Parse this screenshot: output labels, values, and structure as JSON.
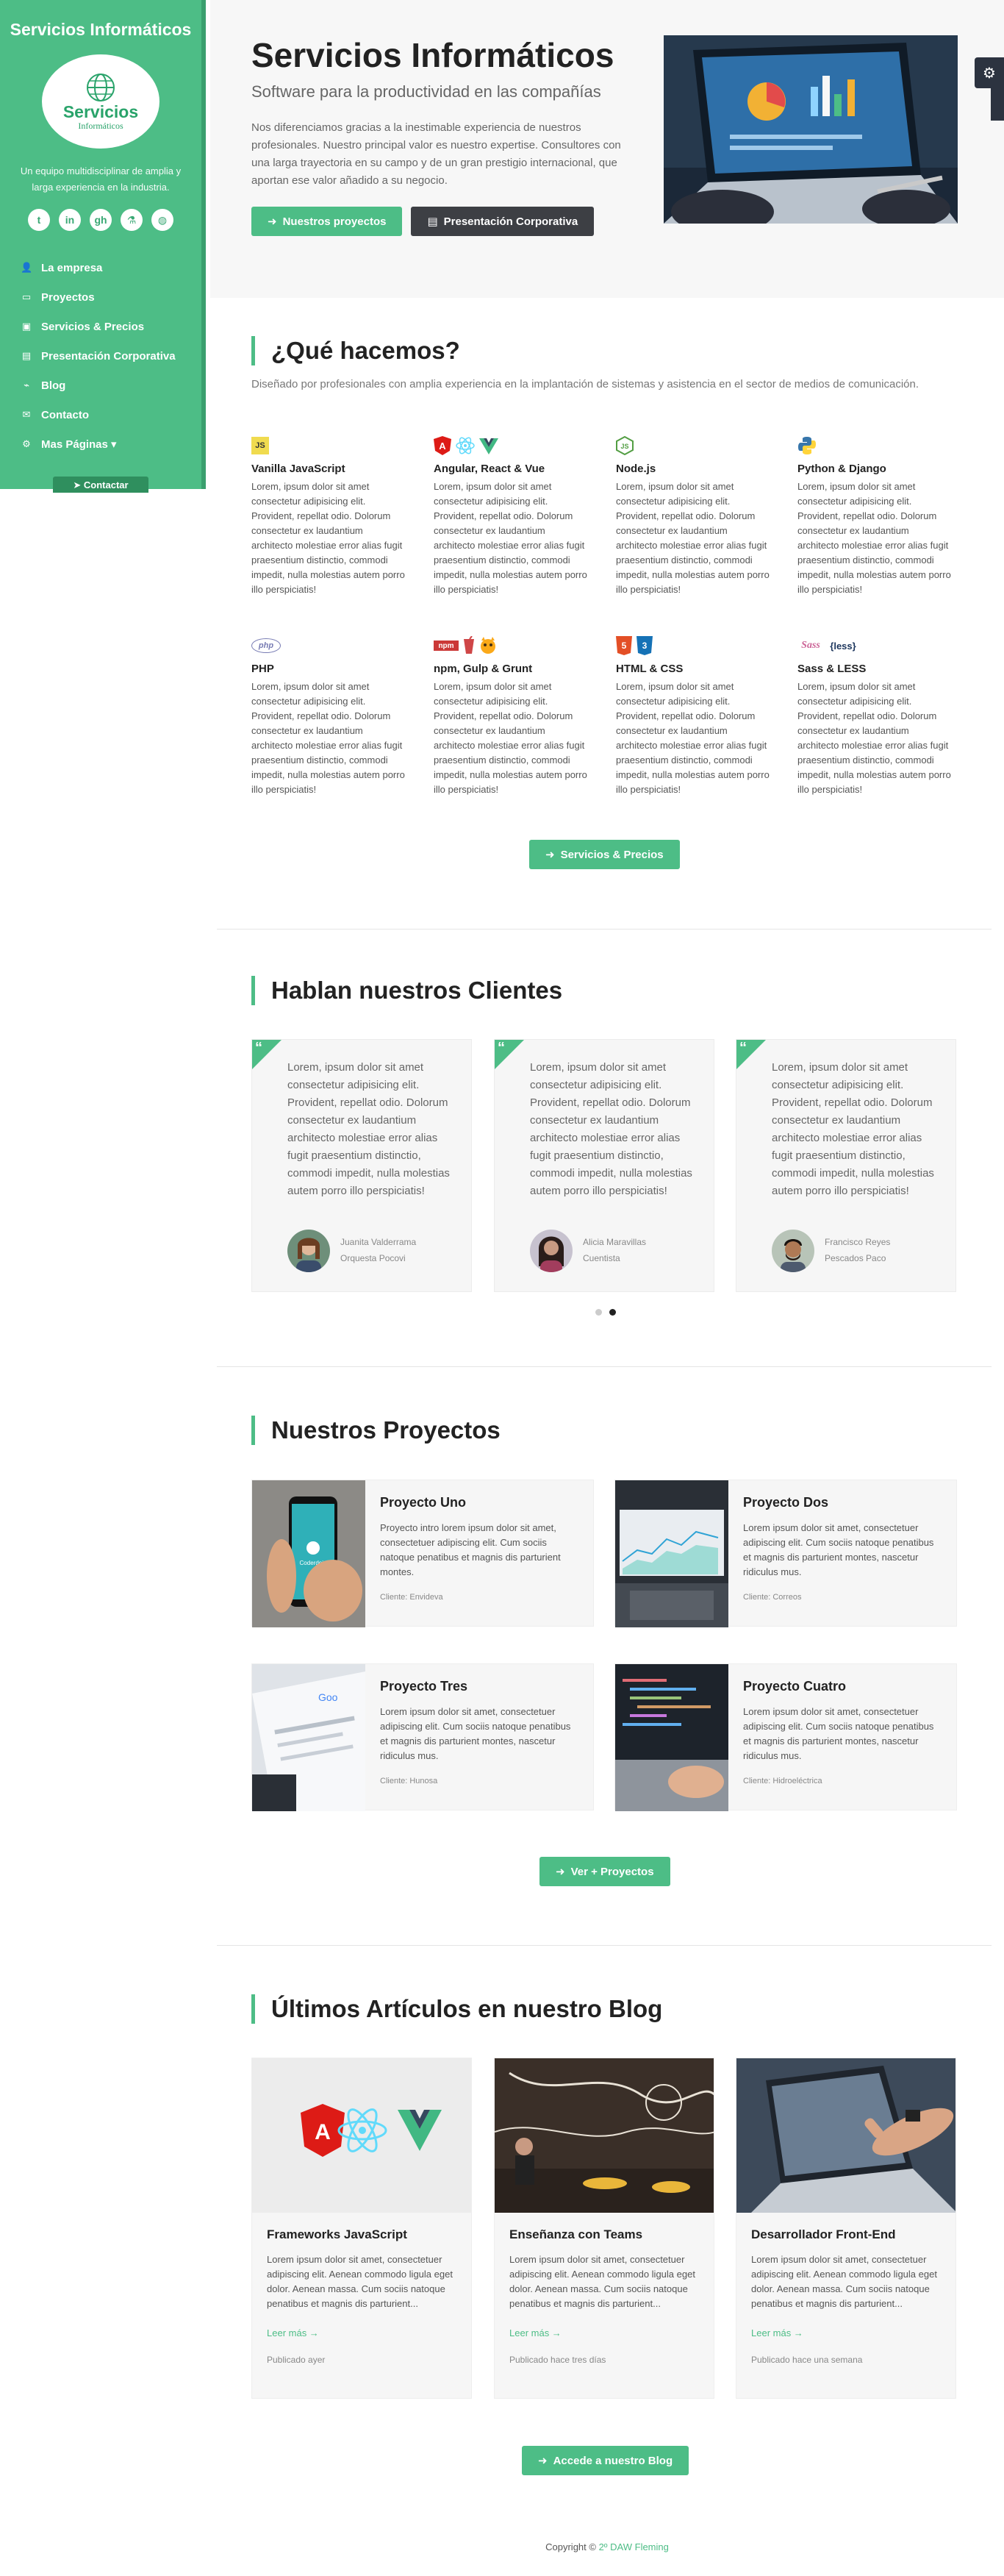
{
  "sidebar": {
    "title": "Servicios Informáticos",
    "logo_line1": "Servicios",
    "logo_line2": "Informáticos",
    "tagline": "Un equipo multidisciplinar de amplia y larga experiencia en la industria.",
    "social": [
      {
        "icon": "twitter-icon",
        "glyph": "t"
      },
      {
        "icon": "linkedin-icon",
        "glyph": "in"
      },
      {
        "icon": "github-icon",
        "glyph": "gh"
      },
      {
        "icon": "flask-icon",
        "glyph": "⚗"
      },
      {
        "icon": "globe-icon",
        "glyph": "◍"
      }
    ],
    "nav": [
      {
        "label": "La empresa",
        "icon": "user-icon",
        "glyph": "👤"
      },
      {
        "label": "Proyectos",
        "icon": "monitor-icon",
        "glyph": "▭"
      },
      {
        "label": "Servicios & Precios",
        "icon": "briefcase-icon",
        "glyph": "▣"
      },
      {
        "label": "Presentación Corporativa",
        "icon": "file-icon",
        "glyph": "▤"
      },
      {
        "label": "Blog",
        "icon": "rss-icon",
        "glyph": "⌁"
      },
      {
        "label": "Contacto",
        "icon": "envelope-icon",
        "glyph": "✉"
      },
      {
        "label": "Mas Páginas ▾",
        "icon": "cogs-icon",
        "glyph": "⚙"
      }
    ],
    "contact_button": "Contactar"
  },
  "hero": {
    "title": "Servicios Informáticos",
    "subtitle": "Software para la productividad en las compañías",
    "text": "Nos diferenciamos gracias a la inestimable experiencia de nuestros profesionales. Nuestro principal valor es nuestro expertise. Consultores con una larga trayectoria en su campo y de un gran prestigio internacional, que aportan ese valor añadido a su negocio.",
    "btn_projects": "Nuestros proyectos",
    "btn_presentation": "Presentación Corporativa"
  },
  "services": {
    "title": "¿Qué hacemos?",
    "subtitle": "Diseñado por profesionales con amplia experiencia en la implantación de sistemas y asistencia en el sector de medios de comunicación.",
    "items": [
      {
        "name": "Vanilla JavaScript",
        "text": "Lorem, ipsum dolor sit amet consectetur adipisicing elit. Provident, repellat odio. Dolorum consectetur ex laudantium architecto molestiae error alias fugit praesentium distinctio, commodi impedit, nulla molestias autem porro illo perspiciatis!"
      },
      {
        "name": "Angular, React & Vue",
        "text": "Lorem, ipsum dolor sit amet consectetur adipisicing elit. Provident, repellat odio. Dolorum consectetur ex laudantium architecto molestiae error alias fugit praesentium distinctio, commodi impedit, nulla molestias autem porro illo perspiciatis!"
      },
      {
        "name": "Node.js",
        "text": "Lorem, ipsum dolor sit amet consectetur adipisicing elit. Provident, repellat odio. Dolorum consectetur ex laudantium architecto molestiae error alias fugit praesentium distinctio, commodi impedit, nulla molestias autem porro illo perspiciatis!"
      },
      {
        "name": "Python & Django",
        "text": "Lorem, ipsum dolor sit amet consectetur adipisicing elit. Provident, repellat odio. Dolorum consectetur ex laudantium architecto molestiae error alias fugit praesentium distinctio, commodi impedit, nulla molestias autem porro illo perspiciatis!"
      },
      {
        "name": "PHP",
        "text": "Lorem, ipsum dolor sit amet consectetur adipisicing elit. Provident, repellat odio. Dolorum consectetur ex laudantium architecto molestiae error alias fugit praesentium distinctio, commodi impedit, nulla molestias autem porro illo perspiciatis!"
      },
      {
        "name": "npm, Gulp & Grunt",
        "text": "Lorem, ipsum dolor sit amet consectetur adipisicing elit. Provident, repellat odio. Dolorum consectetur ex laudantium architecto molestiae error alias fugit praesentium distinctio, commodi impedit, nulla molestias autem porro illo perspiciatis!"
      },
      {
        "name": "HTML & CSS",
        "text": "Lorem, ipsum dolor sit amet consectetur adipisicing elit. Provident, repellat odio. Dolorum consectetur ex laudantium architecto molestiae error alias fugit praesentium distinctio, commodi impedit, nulla molestias autem porro illo perspiciatis!"
      },
      {
        "name": "Sass & LESS",
        "text": "Lorem, ipsum dolor sit amet consectetur adipisicing elit. Provident, repellat odio. Dolorum consectetur ex laudantium architecto molestiae error alias fugit praesentium distinctio, commodi impedit, nulla molestias autem porro illo perspiciatis!"
      }
    ],
    "icon_labels": {
      "js": "JS",
      "php": "php",
      "npm": "npm",
      "less": "{less}",
      "sass": "Sass"
    },
    "button": "Servicios & Precios"
  },
  "testimonials": {
    "title": "Hablan nuestros Clientes",
    "items": [
      {
        "text": "Lorem, ipsum dolor sit amet consectetur adipisicing elit. Provident, repellat odio. Dolorum consectetur ex laudantium architecto molestiae error alias fugit praesentium distinctio, commodi impedit, nulla molestias autem porro illo perspiciatis!",
        "name": "Juanita Valderrama",
        "company": "Orquesta Pocovi"
      },
      {
        "text": "Lorem, ipsum dolor sit amet consectetur adipisicing elit. Provident, repellat odio. Dolorum consectetur ex laudantium architecto molestiae error alias fugit praesentium distinctio, commodi impedit, nulla molestias autem porro illo perspiciatis!",
        "name": "Alicia Maravillas",
        "company": "Cuentista"
      },
      {
        "text": "Lorem, ipsum dolor sit amet consectetur adipisicing elit. Provident, repellat odio. Dolorum consectetur ex laudantium architecto molestiae error alias fugit praesentium distinctio, commodi impedit, nulla molestias autem porro illo perspiciatis!",
        "name": "Francisco Reyes",
        "company": "Pescados Paco"
      }
    ]
  },
  "projects": {
    "title": "Nuestros Proyectos",
    "items": [
      {
        "name": "Proyecto Uno",
        "text": "Proyecto intro lorem ipsum dolor sit amet, consectetuer adipiscing elit. Cum sociis natoque penatibus et magnis dis parturient montes.",
        "client": "Cliente: Envideva"
      },
      {
        "name": "Proyecto Dos",
        "text": "Lorem ipsum dolor sit amet, consectetuer adipiscing elit. Cum sociis natoque penatibus et magnis dis parturient montes, nascetur ridiculus mus.",
        "client": "Cliente: Correos"
      },
      {
        "name": "Proyecto Tres",
        "text": "Lorem ipsum dolor sit amet, consectetuer adipiscing elit. Cum sociis natoque penatibus et magnis dis parturient montes, nascetur ridiculus mus.",
        "client": "Cliente: Hunosa"
      },
      {
        "name": "Proyecto Cuatro",
        "text": "Lorem ipsum dolor sit amet, consectetuer adipiscing elit. Cum sociis natoque penatibus et magnis dis parturient montes, nascetur ridiculus mus.",
        "client": "Cliente: Hidroeléctrica"
      }
    ],
    "phone_app_label": "Coderdojo",
    "button": "Ver + Proyectos"
  },
  "blog": {
    "title": "Últimos Artículos en nuestro Blog",
    "items": [
      {
        "title": "Frameworks JavaScript",
        "text": "Lorem ipsum dolor sit amet, consectetuer adipiscing elit. Aenean commodo ligula eget dolor. Aenean massa. Cum sociis natoque penatibus et magnis dis parturient...",
        "more": "Leer más →",
        "published": "Publicado ayer"
      },
      {
        "title": "Enseñanza con Teams",
        "text": "Lorem ipsum dolor sit amet, consectetuer adipiscing elit. Aenean commodo ligula eget dolor. Aenean massa. Cum sociis natoque penatibus et magnis dis parturient...",
        "more": "Leer más →",
        "published": "Publicado hace tres días"
      },
      {
        "title": "Desarrollador Front-End",
        "text": "Lorem ipsum dolor sit amet, consectetuer adipiscing elit. Aenean commodo ligula eget dolor. Aenean massa. Cum sociis natoque penatibus et magnis dis parturient...",
        "more": "Leer más →",
        "published": "Publicado hace una semana"
      }
    ],
    "button": "Accede a nuestro Blog"
  },
  "footer": {
    "copyright": "Copyright ©",
    "credit": "2º DAW Fleming"
  },
  "colors": {
    "accent": "#4dbd86",
    "dark": "#3d3f44"
  }
}
